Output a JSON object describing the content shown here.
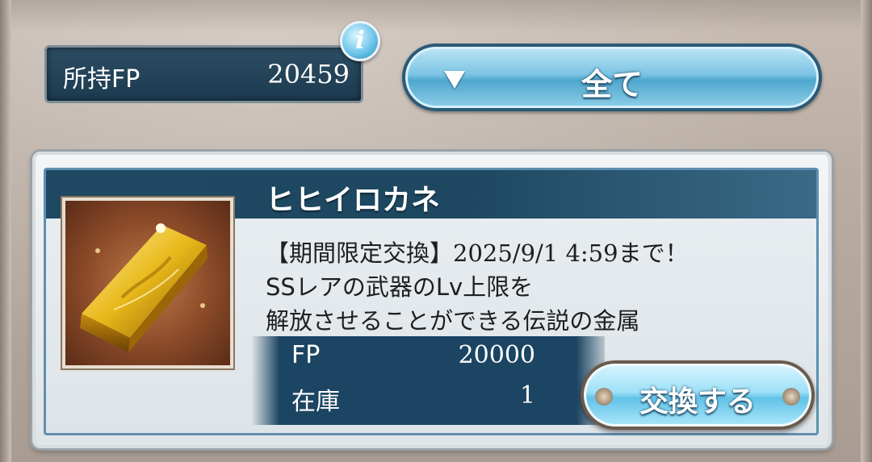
{
  "header": {
    "fp_label": "所持FP",
    "fp_value": "20459",
    "info_icon": "info-icon",
    "filter_label": "全て",
    "filter_icon": "triangle-down-icon"
  },
  "item": {
    "name": "ヒヒイロカネ",
    "image": "gold-ingot-image",
    "description": [
      "【期間限定交換】2025/9/1 4:59まで！",
      "SSレアの武器のLv上限を",
      "解放させることができる伝説の金属"
    ],
    "cost_label": "FP",
    "cost_value": "20000",
    "stock_label": "在庫",
    "stock_value": "1",
    "exchange_label": "交換する"
  },
  "colors": {
    "panel_navy": "#1c4563",
    "button_blue": "#7cc4e4",
    "card_bg": "#e9eef1"
  }
}
